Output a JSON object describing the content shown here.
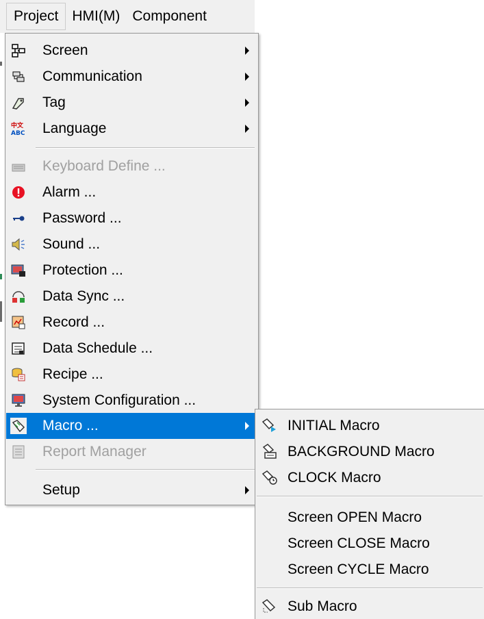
{
  "menubar": {
    "items": [
      {
        "label": "Project"
      },
      {
        "label": "HMI(M)"
      },
      {
        "label": "Component"
      }
    ]
  },
  "project_menu": {
    "items": [
      {
        "label": "Screen",
        "icon": "screen-icon",
        "submenu": true
      },
      {
        "label": "Communication",
        "icon": "communication-icon",
        "submenu": true
      },
      {
        "label": "Tag",
        "icon": "tag-icon",
        "submenu": true
      },
      {
        "label": "Language",
        "icon": "language-icon",
        "submenu": true
      },
      {
        "label": "Keyboard Define ...",
        "icon": "keyboard-icon",
        "disabled": true
      },
      {
        "label": "Alarm ...",
        "icon": "alarm-icon"
      },
      {
        "label": "Password ...",
        "icon": "key-icon"
      },
      {
        "label": "Sound ...",
        "icon": "speaker-icon"
      },
      {
        "label": "Protection ...",
        "icon": "protection-icon"
      },
      {
        "label": "Data Sync ...",
        "icon": "data-sync-icon"
      },
      {
        "label": "Record ...",
        "icon": "record-icon"
      },
      {
        "label": "Data Schedule ...",
        "icon": "schedule-icon"
      },
      {
        "label": "Recipe ...",
        "icon": "recipe-icon"
      },
      {
        "label": "System Configuration ...",
        "icon": "system-configuration-icon"
      },
      {
        "label": "Macro ...",
        "icon": "macro-icon",
        "submenu": true,
        "highlighted": true
      },
      {
        "label": "Report Manager",
        "icon": "report-icon",
        "disabled": true
      },
      {
        "label": "Setup",
        "submenu": true
      }
    ]
  },
  "macro_submenu": {
    "items": [
      {
        "label": "INITIAL Macro",
        "icon": "initial-macro-icon"
      },
      {
        "label": "BACKGROUND Macro",
        "icon": "background-macro-icon"
      },
      {
        "label": "CLOCK Macro",
        "icon": "clock-macro-icon"
      },
      {
        "label": "Screen OPEN Macro"
      },
      {
        "label": "Screen CLOSE Macro"
      },
      {
        "label": "Screen CYCLE Macro"
      },
      {
        "label": "Sub Macro",
        "icon": "sub-macro-icon"
      }
    ]
  },
  "colors": {
    "menu_bg": "#f0f0f0",
    "highlight": "#0078d7",
    "disabled_text": "#a0a0a0",
    "alarm_red": "#e81123"
  }
}
